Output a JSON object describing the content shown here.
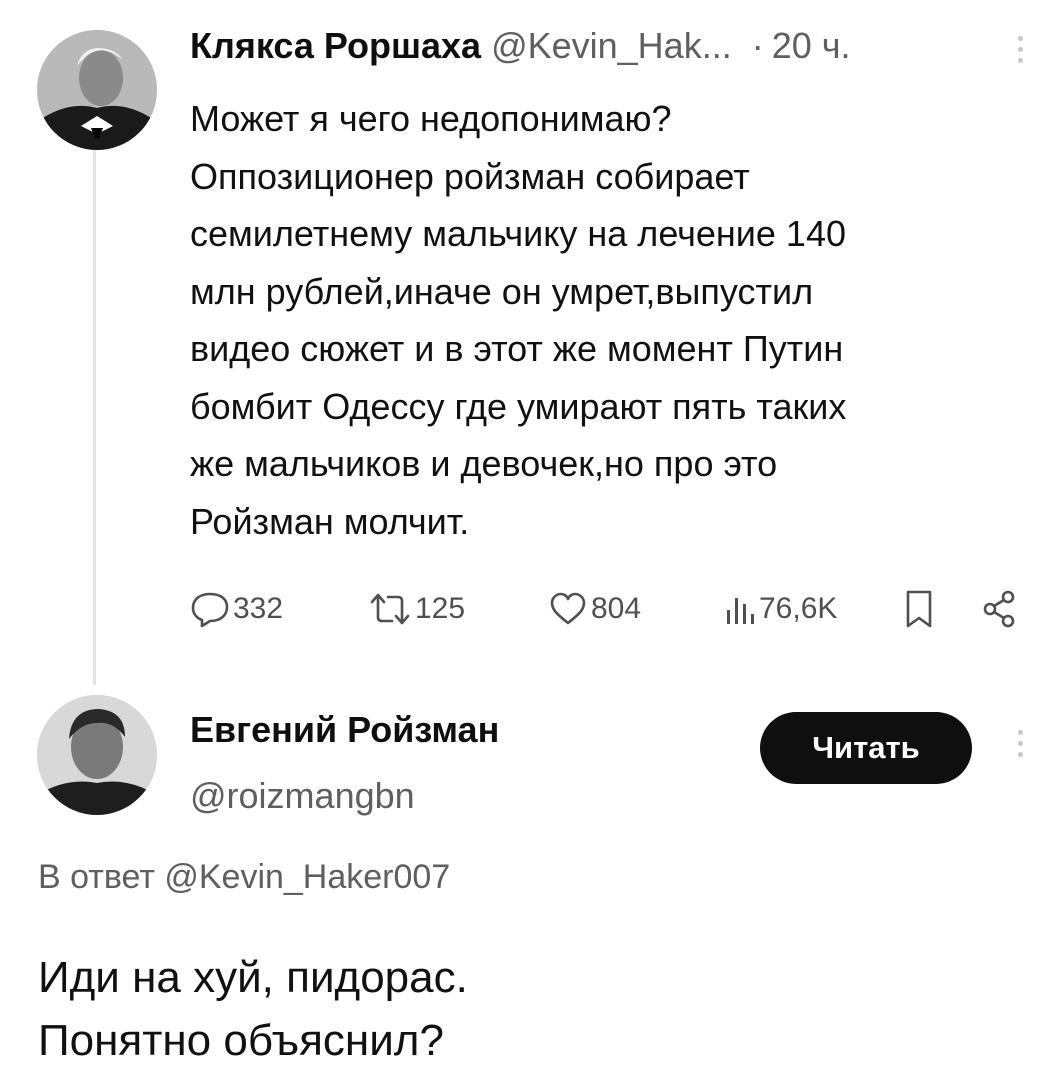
{
  "tweet": {
    "author_name": "Клякса Роршаха",
    "author_handle": "@Kevin_Hak...",
    "separator": "·",
    "time": "20 ч.",
    "text": "Может я чего недопонимаю?\nОппозиционер ройзман собирает\nсемилетнему мальчику на лечение 140\nмлн рублей,иначе он умрет,выпустил\nвидео сюжет и в этот же момент Путин\nбомбит Одессу где умирают пять таких\nже мальчиков и девочек,но про это\nРойзман молчит.",
    "actions": {
      "replies": "332",
      "reposts": "125",
      "likes": "804",
      "views": "76,6K"
    },
    "icons": [
      "reply-icon",
      "repost-icon",
      "like-icon",
      "views-icon",
      "bookmark-icon",
      "share-icon",
      "more-icon"
    ]
  },
  "reply": {
    "author_name": "Евгений Ройзман",
    "author_handle": "@roizmangbn",
    "follow_label": "Читать",
    "context": "В ответ @Kevin_Haker007",
    "text": "Иди на хуй, пидорас.\nПонятно объяснил?"
  },
  "colors": {
    "text": "#0f0f0f",
    "secondary": "#5f5f5f",
    "button_bg": "#0f0f0f",
    "button_text": "#ffffff",
    "thread_line": "#e3e3e3"
  }
}
